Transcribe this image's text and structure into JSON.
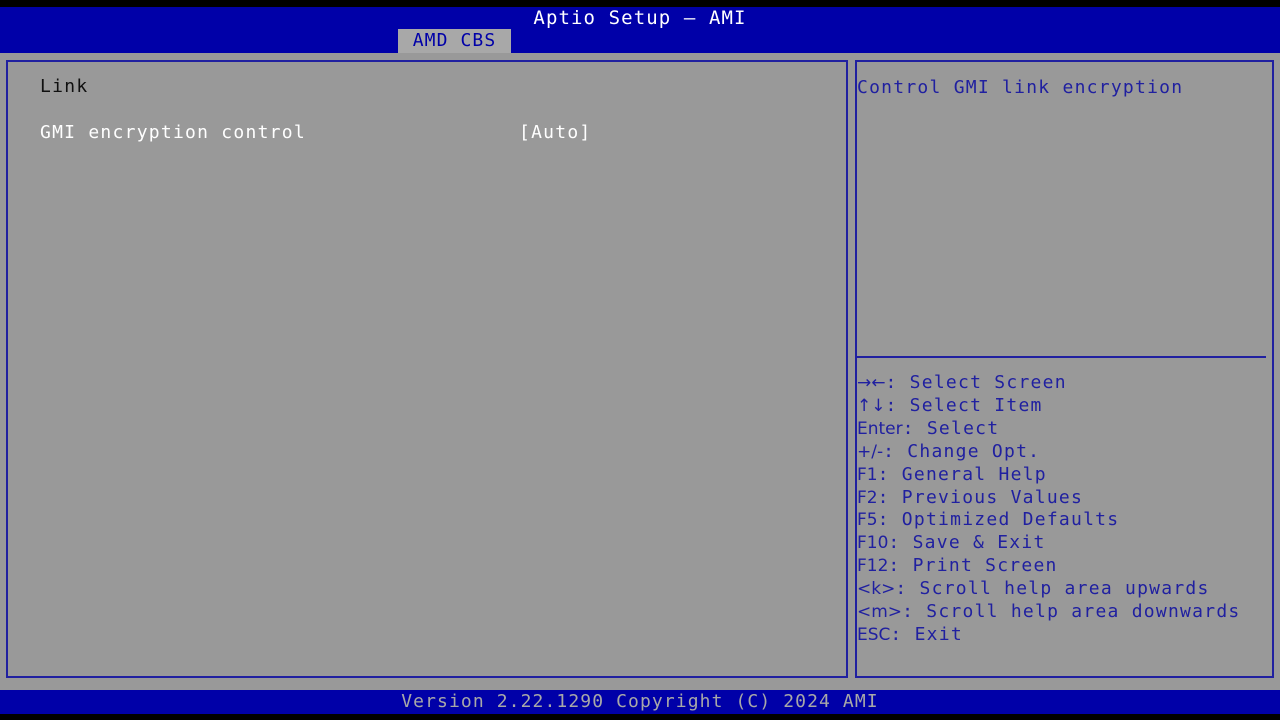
{
  "header": {
    "title": "Aptio Setup – AMI",
    "tabs": [
      {
        "label": "AMD CBS",
        "active": true
      }
    ]
  },
  "main": {
    "group_heading": "Link",
    "settings": [
      {
        "label": "GMI encryption control",
        "value": "[Auto]"
      }
    ]
  },
  "help": {
    "text": "Control GMI link encryption",
    "legend": [
      {
        "key": "→←",
        "text": ": Select Screen"
      },
      {
        "key": "↑↓",
        "text": ": Select Item"
      },
      {
        "key": "Enter",
        "text": ": Select"
      },
      {
        "key": "+/-",
        "text": ": Change Opt."
      },
      {
        "key": "F1",
        "text": ": General Help"
      },
      {
        "key": "F2",
        "text": ": Previous Values"
      },
      {
        "key": "F5",
        "text": ": Optimized Defaults"
      },
      {
        "key": "F10",
        "text": ": Save & Exit"
      },
      {
        "key": "F12",
        "text": ": Print Screen"
      },
      {
        "key": "<k>",
        "text": ": Scroll help area upwards"
      },
      {
        "key": "<m>",
        "text": ": Scroll help area downwards"
      },
      {
        "key": "ESC",
        "text": ": Exit"
      }
    ]
  },
  "footer": {
    "version_text": "Version 2.22.1290 Copyright (C) 2024 AMI"
  },
  "colors": {
    "header_blue": "#0000a8",
    "panel_border": "#2020a0",
    "background_gray": "#999999",
    "tab_gray": "#a8a8a8",
    "help_text_blue": "#2020a0",
    "setting_text": "#ffffff",
    "heading_text": "#101010",
    "footer_text": "#a8a8a8"
  }
}
